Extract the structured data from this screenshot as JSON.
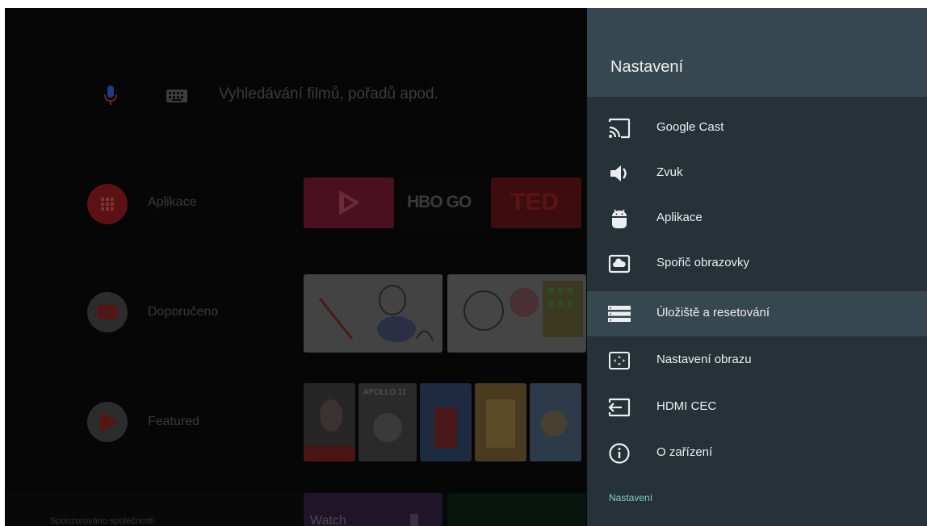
{
  "home": {
    "search": {
      "placeholder": "Vyhledávání filmů, pořadů apod."
    },
    "rows": [
      {
        "label": "Aplikace",
        "color": "#6e1414"
      },
      {
        "label": "Doporučeno",
        "color": "#3a3a3a"
      },
      {
        "label": "Featured",
        "color": "#3a3a3a"
      }
    ],
    "apps": {
      "hbo": "HBO GO",
      "ted": "TED"
    },
    "posters": {
      "apollo": "APOLLO 11"
    },
    "sponsored": "Sponzorováno společností",
    "watch": "Watch"
  },
  "settings": {
    "title": "Nastavení",
    "items": [
      {
        "label": "Google Cast",
        "icon": "cast-icon"
      },
      {
        "label": "Zvuk",
        "icon": "volume-icon"
      },
      {
        "label": "Aplikace",
        "icon": "android-icon"
      },
      {
        "label": "Spořič obrazovky",
        "icon": "screensaver-icon"
      },
      {
        "label": "Úložiště a resetování",
        "icon": "storage-icon",
        "selected": true
      },
      {
        "label": "Nastavení obrazu",
        "icon": "picture-settings-icon"
      },
      {
        "label": "HDMI CEC",
        "icon": "hdmi-input-icon"
      },
      {
        "label": "O zařízení",
        "icon": "info-icon"
      }
    ],
    "breadcrumb": "Nastavení"
  },
  "colors": {
    "panel": "#263238",
    "panel_header": "#37474f",
    "accent": "#7fd1c3"
  }
}
